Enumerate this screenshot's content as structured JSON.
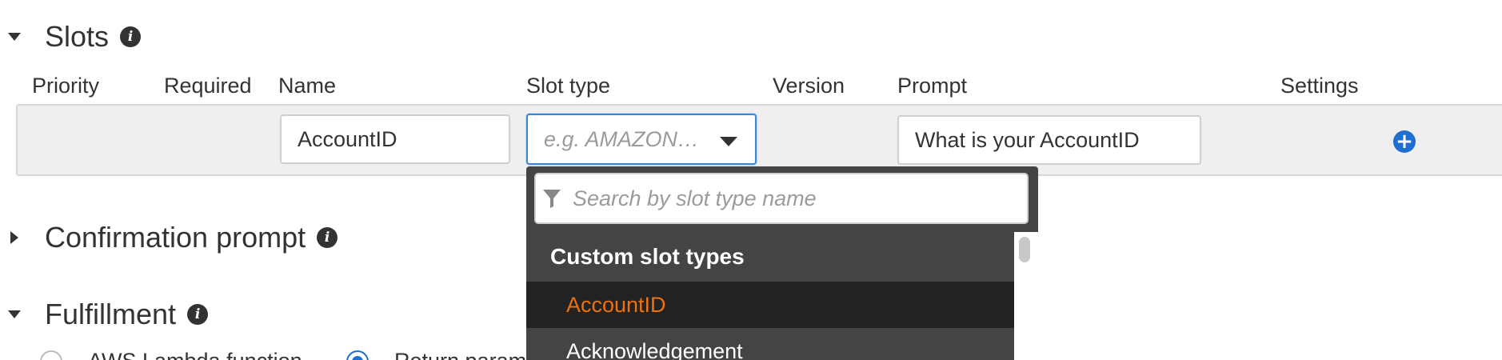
{
  "sections": {
    "slots": {
      "title": "Slots"
    },
    "confirmation": {
      "title": "Confirmation prompt"
    },
    "fulfillment": {
      "title": "Fulfillment"
    }
  },
  "columns": {
    "priority": "Priority",
    "required": "Required",
    "name": "Name",
    "slot_type": "Slot type",
    "version": "Version",
    "prompt": "Prompt",
    "settings": "Settings"
  },
  "slot_row": {
    "name_value": "AccountID",
    "slot_type_placeholder": "e.g. AMAZON…",
    "prompt_value": "What is your AccountID"
  },
  "dropdown": {
    "search_placeholder": "Search by slot type name",
    "group_label": "Custom slot types",
    "items": [
      {
        "label": "AccountID",
        "active": true
      },
      {
        "label": "Acknowledgement",
        "active": false
      }
    ]
  },
  "fulfillment_options": {
    "lambda_label": "AWS Lambda function",
    "return_label": "Return parameters to client"
  },
  "colors": {
    "accent_blue": "#1f6fd1",
    "focus_border": "#3a87d6",
    "dropdown_bg": "#444444",
    "active_item_text": "#ec7211"
  },
  "icons": {
    "info": "info-icon",
    "add": "plus-circle-icon",
    "filter": "filter-icon",
    "expand": "caret-down-icon",
    "collapse": "caret-right-icon"
  }
}
